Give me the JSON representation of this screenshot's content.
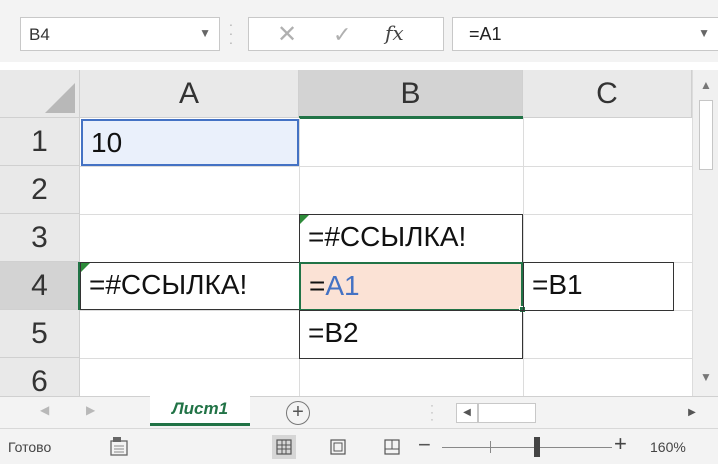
{
  "formula_bar": {
    "name_box": "B4",
    "cancel_icon": "cancel-icon",
    "enter_icon": "enter-icon",
    "fx_label": "fx",
    "formula": "=A1"
  },
  "columns": [
    "A",
    "B",
    "C"
  ],
  "rows": [
    "1",
    "2",
    "3",
    "4",
    "5",
    "6"
  ],
  "selected_cell": "B4",
  "cells": {
    "A1": "10",
    "A4": "=#ССЫЛКА!",
    "B3": "=#ССЫЛКА!",
    "B4_prefix": "=",
    "B4_ref": "A1",
    "B5": "=B2",
    "C4": "=B1"
  },
  "colors": {
    "accent": "#217346",
    "reference": "#4472c4",
    "active_cell_fill": "#fbe2d5",
    "error_indicator": "#2e8b3a"
  },
  "sheet_tabs": {
    "active": "Лист1",
    "add_icon": "plus-circle-icon"
  },
  "status_bar": {
    "status": "Готово",
    "zoom": "160%"
  }
}
